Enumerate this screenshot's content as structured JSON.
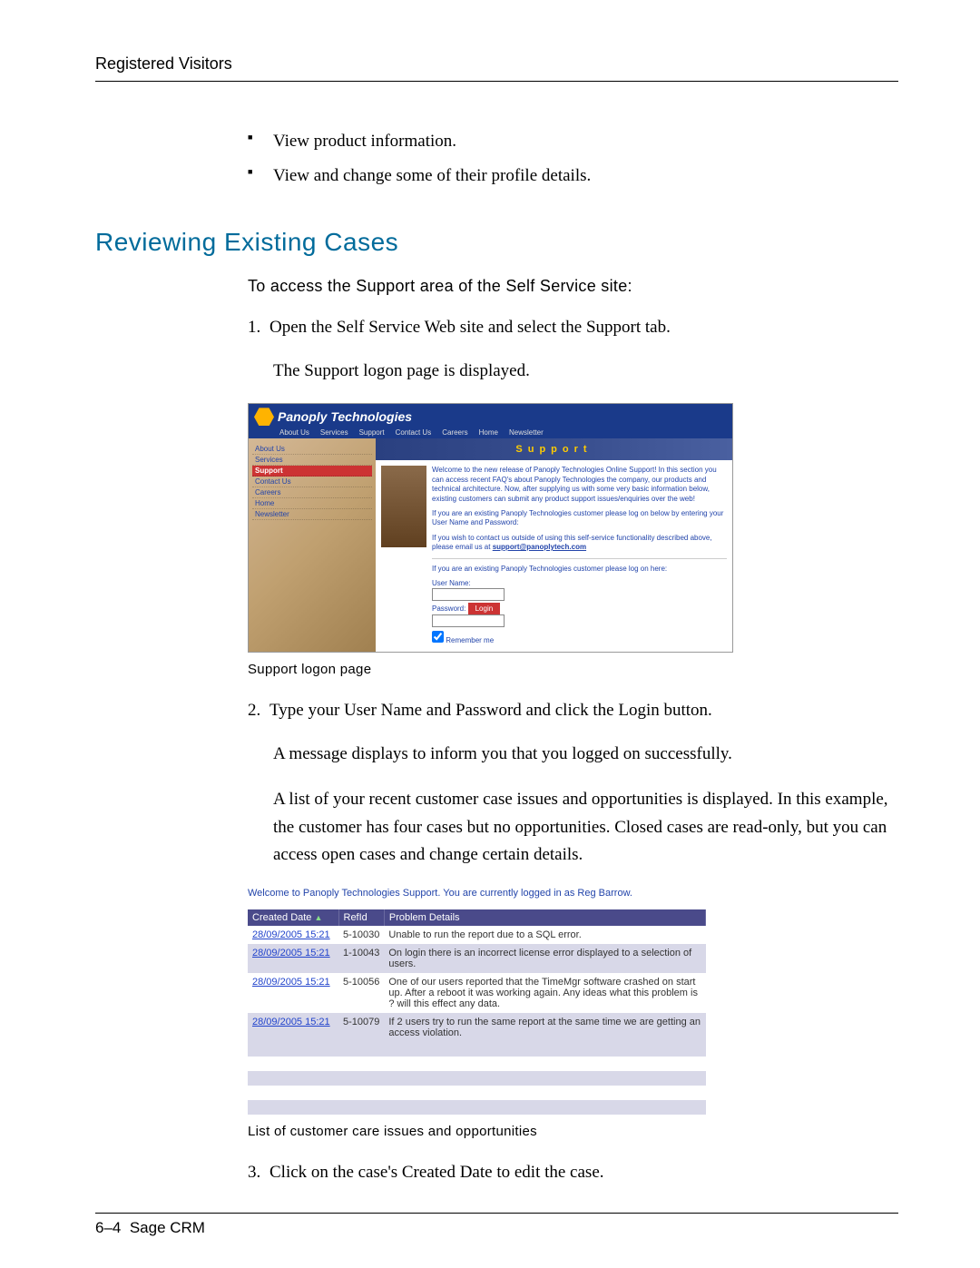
{
  "header": {
    "title": "Registered Visitors"
  },
  "bullets": [
    "View product information.",
    "View and change some of their profile details."
  ],
  "section_title": "Reviewing Existing Cases",
  "intro": "To access the Support area of the Self Service site:",
  "steps": {
    "s1": {
      "num": "1.",
      "text": "Open the Self Service Web site and select the Support tab.",
      "sub": "The Support logon page is displayed."
    },
    "caption1": "Support logon page",
    "s2": {
      "num": "2.",
      "text": "Type your User Name and Password and click the Login button.",
      "sub1": "A message displays to inform you that you logged on successfully.",
      "sub2": "A list of your recent customer case issues and opportunities is displayed. In this example, the customer has four cases but no opportunities. Closed cases are read-only, but you can access open cases and change certain details."
    },
    "caption2": "List of customer care issues and opportunities",
    "s3": {
      "num": "3.",
      "text": "Click on the case's Created Date to edit the case."
    }
  },
  "shot1": {
    "company": "Panoply Technologies",
    "nav": [
      "About Us",
      "Services",
      "Support",
      "Contact Us",
      "Careers",
      "Home",
      "Newsletter"
    ],
    "side": [
      "About Us",
      "Services",
      "Support",
      "Contact Us",
      "Careers",
      "Home",
      "Newsletter"
    ],
    "banner": "Support",
    "p1": "Welcome to the new release of Panoply Technologies Online Support! In this section you can access recent FAQ's about Panoply Technologies the company, our products and technical architecture. Now, after supplying us with some very basic information below, existing customers can submit any product support issues/enquiries over the web!",
    "p2": "If you are an existing Panoply Technologies customer please log on below by entering your User Name and Password:",
    "p3a": "If you wish to contact us outside of using this self-service functionality described above, please email us at ",
    "p3link": "support@panoplytech.com",
    "p4": "If you are an existing Panoply Technologies customer please log on here:",
    "user_label": "User Name:",
    "pass_label": "Password:",
    "login_btn": "Login",
    "remember": "Remember me"
  },
  "shot2": {
    "welcome": "Welcome to Panoply Technologies Support. You are currently logged in as Reg Barrow.",
    "headers": {
      "date": "Created Date",
      "ref": "RefId",
      "prob": "Problem Details"
    },
    "rows": [
      {
        "date": "28/09/2005 15:21",
        "ref": "5-10030",
        "prob": "Unable to run the report due to a SQL error."
      },
      {
        "date": "28/09/2005 15:21",
        "ref": "1-10043",
        "prob": "On login there is an incorrect license error displayed to a selection of users."
      },
      {
        "date": "28/09/2005 15:21",
        "ref": "5-10056",
        "prob": "One of our users reported that the TimeMgr software crashed on start up. After a reboot it was working again. Any ideas what this problem is ? will this effect any data."
      },
      {
        "date": "28/09/2005 15:21",
        "ref": "5-10079",
        "prob": "If 2 users try to run the same report at the same time we are getting an access violation."
      }
    ]
  },
  "footer": {
    "page": "6–4",
    "product": "Sage CRM"
  }
}
